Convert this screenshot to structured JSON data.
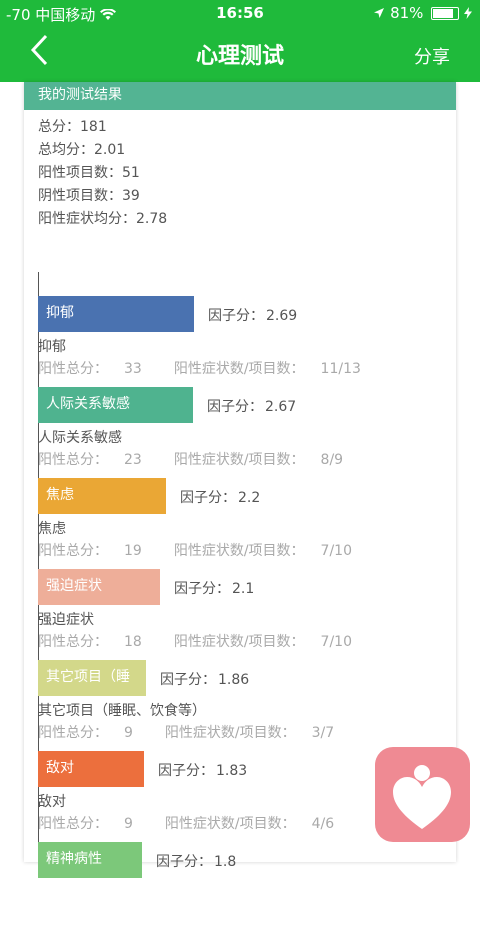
{
  "status_bar": {
    "signal": "-70 中国移动",
    "time": "16:56",
    "battery": "81%"
  },
  "nav": {
    "title": "心理测试",
    "share": "分享"
  },
  "result": {
    "header": "我的测试结果",
    "summary": [
      "总分：181",
      "总均分：2.01",
      "阳性项目数：51",
      "阴性项目数：39",
      "阳性症状均分：2.78"
    ]
  },
  "score_label": "因子分：",
  "positive_total_label": "阳性总分：",
  "ratio_label": "阳性症状数/项目数：",
  "factors": [
    {
      "bar_label": "抑郁",
      "score": "2.69",
      "score_value": 2.69,
      "name": "抑郁",
      "positive_total": "33",
      "ratio": "11/13",
      "color": "#4a72b0"
    },
    {
      "bar_label": "人际关系敏感",
      "score": "2.67",
      "score_value": 2.67,
      "name": "人际关系敏感",
      "positive_total": "23",
      "ratio": "8/9",
      "color": "#4fb38f"
    },
    {
      "bar_label": "焦虑",
      "score": "2.2",
      "score_value": 2.2,
      "name": "焦虑",
      "positive_total": "19",
      "ratio": "7/10",
      "color": "#eaa735"
    },
    {
      "bar_label": "强迫症状",
      "score": "2.1",
      "score_value": 2.1,
      "name": "强迫症状",
      "positive_total": "18",
      "ratio": "7/10",
      "color": "#eeae99"
    },
    {
      "bar_label": "其它项目（睡",
      "score": "1.86",
      "score_value": 1.86,
      "name": "其它项目（睡眠、饮食等）",
      "positive_total": "9",
      "ratio": "3/7",
      "color": "#d3d88a"
    },
    {
      "bar_label": "敌对",
      "score": "1.83",
      "score_value": 1.83,
      "name": "敌对",
      "positive_total": "9",
      "ratio": "4/6",
      "color": "#ec6f3d"
    },
    {
      "bar_label": "精神病性",
      "score": "1.8",
      "score_value": 1.8,
      "name": "",
      "positive_total": "",
      "ratio": "",
      "color": "#7cc87a"
    }
  ],
  "colors": {
    "primary": "#1fba3b",
    "card_header": "#53b493",
    "fab": "#ef8a93"
  },
  "icons": {
    "back": "chevron-left-icon",
    "location": "location-arrow-icon",
    "wifi": "wifi-icon",
    "fab": "heart-person-icon"
  }
}
